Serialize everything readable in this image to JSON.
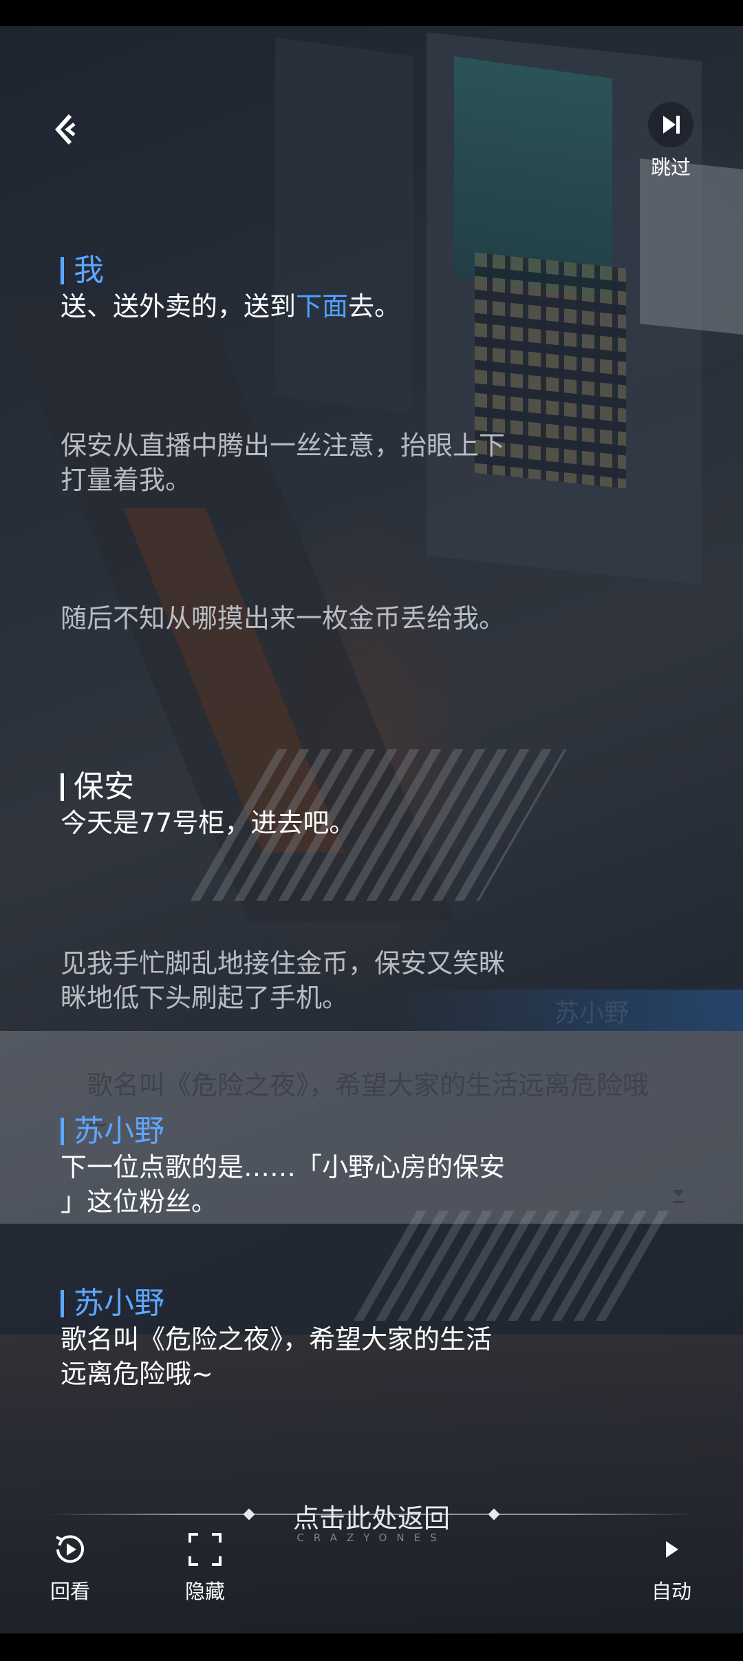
{
  "header": {
    "skip_label": "跳过"
  },
  "log": [
    {
      "type": "dialogue",
      "speaker": "我",
      "text_before": "送、送外卖的，送到",
      "text_highlight": "下面",
      "text_after": "去。"
    },
    {
      "type": "narration",
      "text1": "保安从直播中腾出一丝注意，抬眼上下",
      "text2": "打量着我。"
    },
    {
      "type": "narration",
      "text1": "随后不知从哪摸出来一枚金币丢给我。"
    },
    {
      "type": "dialogue",
      "speaker": "保安",
      "text1": "今天是77号柜，进去吧。"
    },
    {
      "type": "narration",
      "text1": "见我手忙脚乱地接住金币，保安又笑眯",
      "text2": "眯地低下头刷起了手机。"
    },
    {
      "type": "dialogue",
      "speaker": "苏小野",
      "text1": "下一位点歌的是……「小野心房的保安",
      "text2": "」这位粉丝。"
    },
    {
      "type": "dialogue",
      "speaker": "苏小野",
      "text1": "歌名叫《危险之夜》，希望大家的生活",
      "text2": "远离危险哦~"
    }
  ],
  "background_dialog": {
    "speaker": "苏小野",
    "text": "歌名叫《危险之夜》，希望大家的生活远离危险哦~"
  },
  "footer": {
    "return_label": "点击此处返回",
    "brand": "CRAZYONES",
    "replay_label": "回看",
    "hide_label": "隐藏",
    "auto_label": "自动"
  },
  "colors": {
    "speaker_accent": "#5ea6ff",
    "highlight": "#4fa2ff"
  },
  "icons": [
    "back-icon",
    "skip-icon",
    "replay-icon",
    "hide-icon",
    "auto-play-icon",
    "continue-arrow-icon"
  ]
}
